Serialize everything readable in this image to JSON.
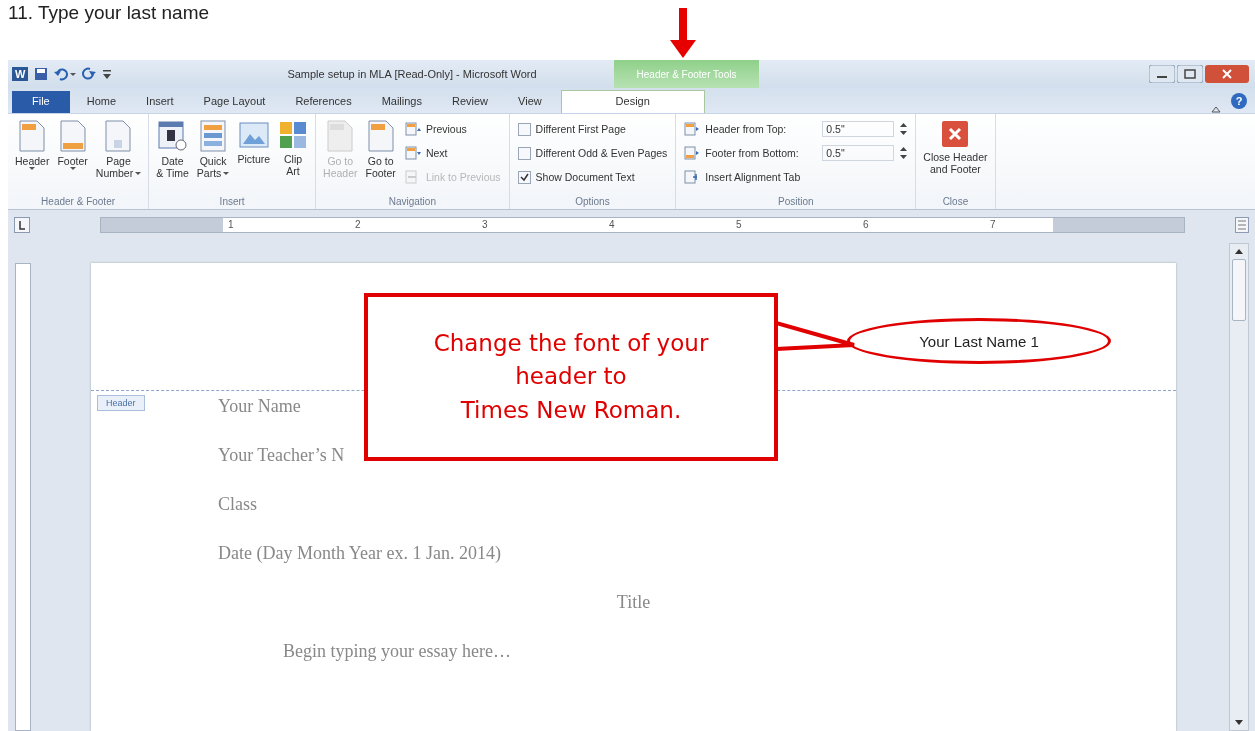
{
  "instruction": "11.  Type your last name",
  "window": {
    "app_logo": "W",
    "title": "Sample setup in MLA [Read-Only] - Microsoft Word",
    "contextual_group": "Header & Footer Tools",
    "help_button": "?"
  },
  "tabs": [
    {
      "label": "File",
      "kind": "file",
      "selected": false
    },
    {
      "label": "Home",
      "kind": "normal",
      "selected": false
    },
    {
      "label": "Insert",
      "kind": "normal",
      "selected": false
    },
    {
      "label": "Page Layout",
      "kind": "normal",
      "selected": false
    },
    {
      "label": "References",
      "kind": "normal",
      "selected": false
    },
    {
      "label": "Mailings",
      "kind": "normal",
      "selected": false
    },
    {
      "label": "Review",
      "kind": "normal",
      "selected": false
    },
    {
      "label": "View",
      "kind": "normal",
      "selected": false
    },
    {
      "label": "Design",
      "kind": "contextual",
      "selected": true
    }
  ],
  "ribbon_groups": [
    {
      "label": "Header & Footer",
      "items": [
        {
          "kind": "large",
          "lines": [
            "Header"
          ],
          "dropdown": true,
          "disabled": false
        },
        {
          "kind": "large",
          "lines": [
            "Footer"
          ],
          "dropdown": true,
          "disabled": false
        },
        {
          "kind": "large",
          "lines": [
            "Page",
            "Number"
          ],
          "dropdown": true,
          "disabled": false
        }
      ]
    },
    {
      "label": "Insert",
      "items": [
        {
          "kind": "large",
          "lines": [
            "Date",
            "& Time"
          ],
          "dropdown": false,
          "disabled": false
        },
        {
          "kind": "large",
          "lines": [
            "Quick",
            "Parts"
          ],
          "dropdown": true,
          "disabled": false
        },
        {
          "kind": "large",
          "lines": [
            "Picture"
          ],
          "dropdown": false,
          "disabled": false
        },
        {
          "kind": "large",
          "lines": [
            "Clip",
            "Art"
          ],
          "dropdown": false,
          "disabled": false
        }
      ]
    },
    {
      "label": "Navigation",
      "items": [
        {
          "kind": "large",
          "lines": [
            "Go to",
            "Header"
          ],
          "dropdown": false,
          "disabled": true
        },
        {
          "kind": "large",
          "lines": [
            "Go to",
            "Footer"
          ],
          "dropdown": false,
          "disabled": false
        },
        {
          "kind": "small",
          "label": "Previous",
          "disabled": false
        },
        {
          "kind": "small",
          "label": "Next",
          "disabled": false
        },
        {
          "kind": "small",
          "label": "Link to Previous",
          "disabled": true
        }
      ]
    },
    {
      "label": "Options",
      "items": [
        {
          "kind": "checkbox",
          "label": "Different First Page",
          "checked": false
        },
        {
          "kind": "checkbox",
          "label": "Different Odd & Even Pages",
          "checked": false
        },
        {
          "kind": "checkbox",
          "label": "Show Document Text",
          "checked": true
        }
      ]
    },
    {
      "label": "Position",
      "items": [
        {
          "kind": "spinner",
          "label": "Header from Top:",
          "value": "0.5\""
        },
        {
          "kind": "spinner",
          "label": "Footer from Bottom:",
          "value": "0.5\""
        },
        {
          "kind": "small",
          "label": "Insert Alignment Tab",
          "disabled": false
        }
      ]
    },
    {
      "label": "Close",
      "items": [
        {
          "kind": "large",
          "lines": [
            "Close Header",
            "and Footer"
          ],
          "dropdown": false,
          "disabled": false
        }
      ]
    }
  ],
  "ruler": {
    "numbers": [
      "1",
      "2",
      "3",
      "4",
      "5",
      "6",
      "7"
    ]
  },
  "document": {
    "header_text": "Your Last Name 1",
    "header_tag": "Header",
    "lines": [
      {
        "text": "Your Name",
        "kind": "left"
      },
      {
        "text": "Your Teacher’s N",
        "kind": "left"
      },
      {
        "text": "Class",
        "kind": "left"
      },
      {
        "text": "Date (Day Month Year ex. 1 Jan. 2014)",
        "kind": "left"
      },
      {
        "text": "Title",
        "kind": "center"
      },
      {
        "text": "Begin typing your essay here…",
        "kind": "indent"
      }
    ]
  },
  "callout": {
    "lines": [
      "Change the font of your",
      "header to",
      "Times New Roman."
    ]
  }
}
